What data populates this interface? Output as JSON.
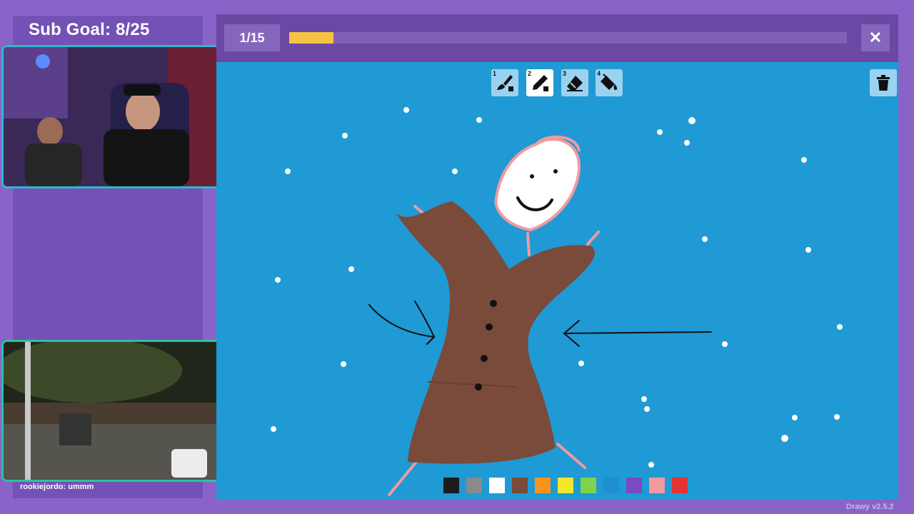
{
  "overlay": {
    "sub_goal": "Sub Goal: 8/25",
    "chat_line": "rookiejordo: ummm"
  },
  "game": {
    "round": "1/15",
    "progress": 0.08,
    "close_label": "✕",
    "version": "Drawy v2.5.2",
    "tools": [
      {
        "num": "1",
        "name": "brush",
        "selected": false
      },
      {
        "num": "2",
        "name": "pencil",
        "selected": true
      },
      {
        "num": "3",
        "name": "eraser",
        "selected": false
      },
      {
        "num": "4",
        "name": "fill-bucket",
        "selected": false
      }
    ],
    "palette": [
      "#1c1c1c",
      "#8a8a8a",
      "#ffffff",
      "#7a4a3a",
      "#f7941d",
      "#f2e829",
      "#7ed348",
      "#1f8fd0",
      "#7a4ac0",
      "#f09aa0",
      "#e53232"
    ]
  },
  "colors": {
    "accent": "#8a63c9",
    "canvas": "#1f9ad4",
    "progress": "#f5c342",
    "coat": "#7a4a3a",
    "pink": "#f09aa0"
  }
}
